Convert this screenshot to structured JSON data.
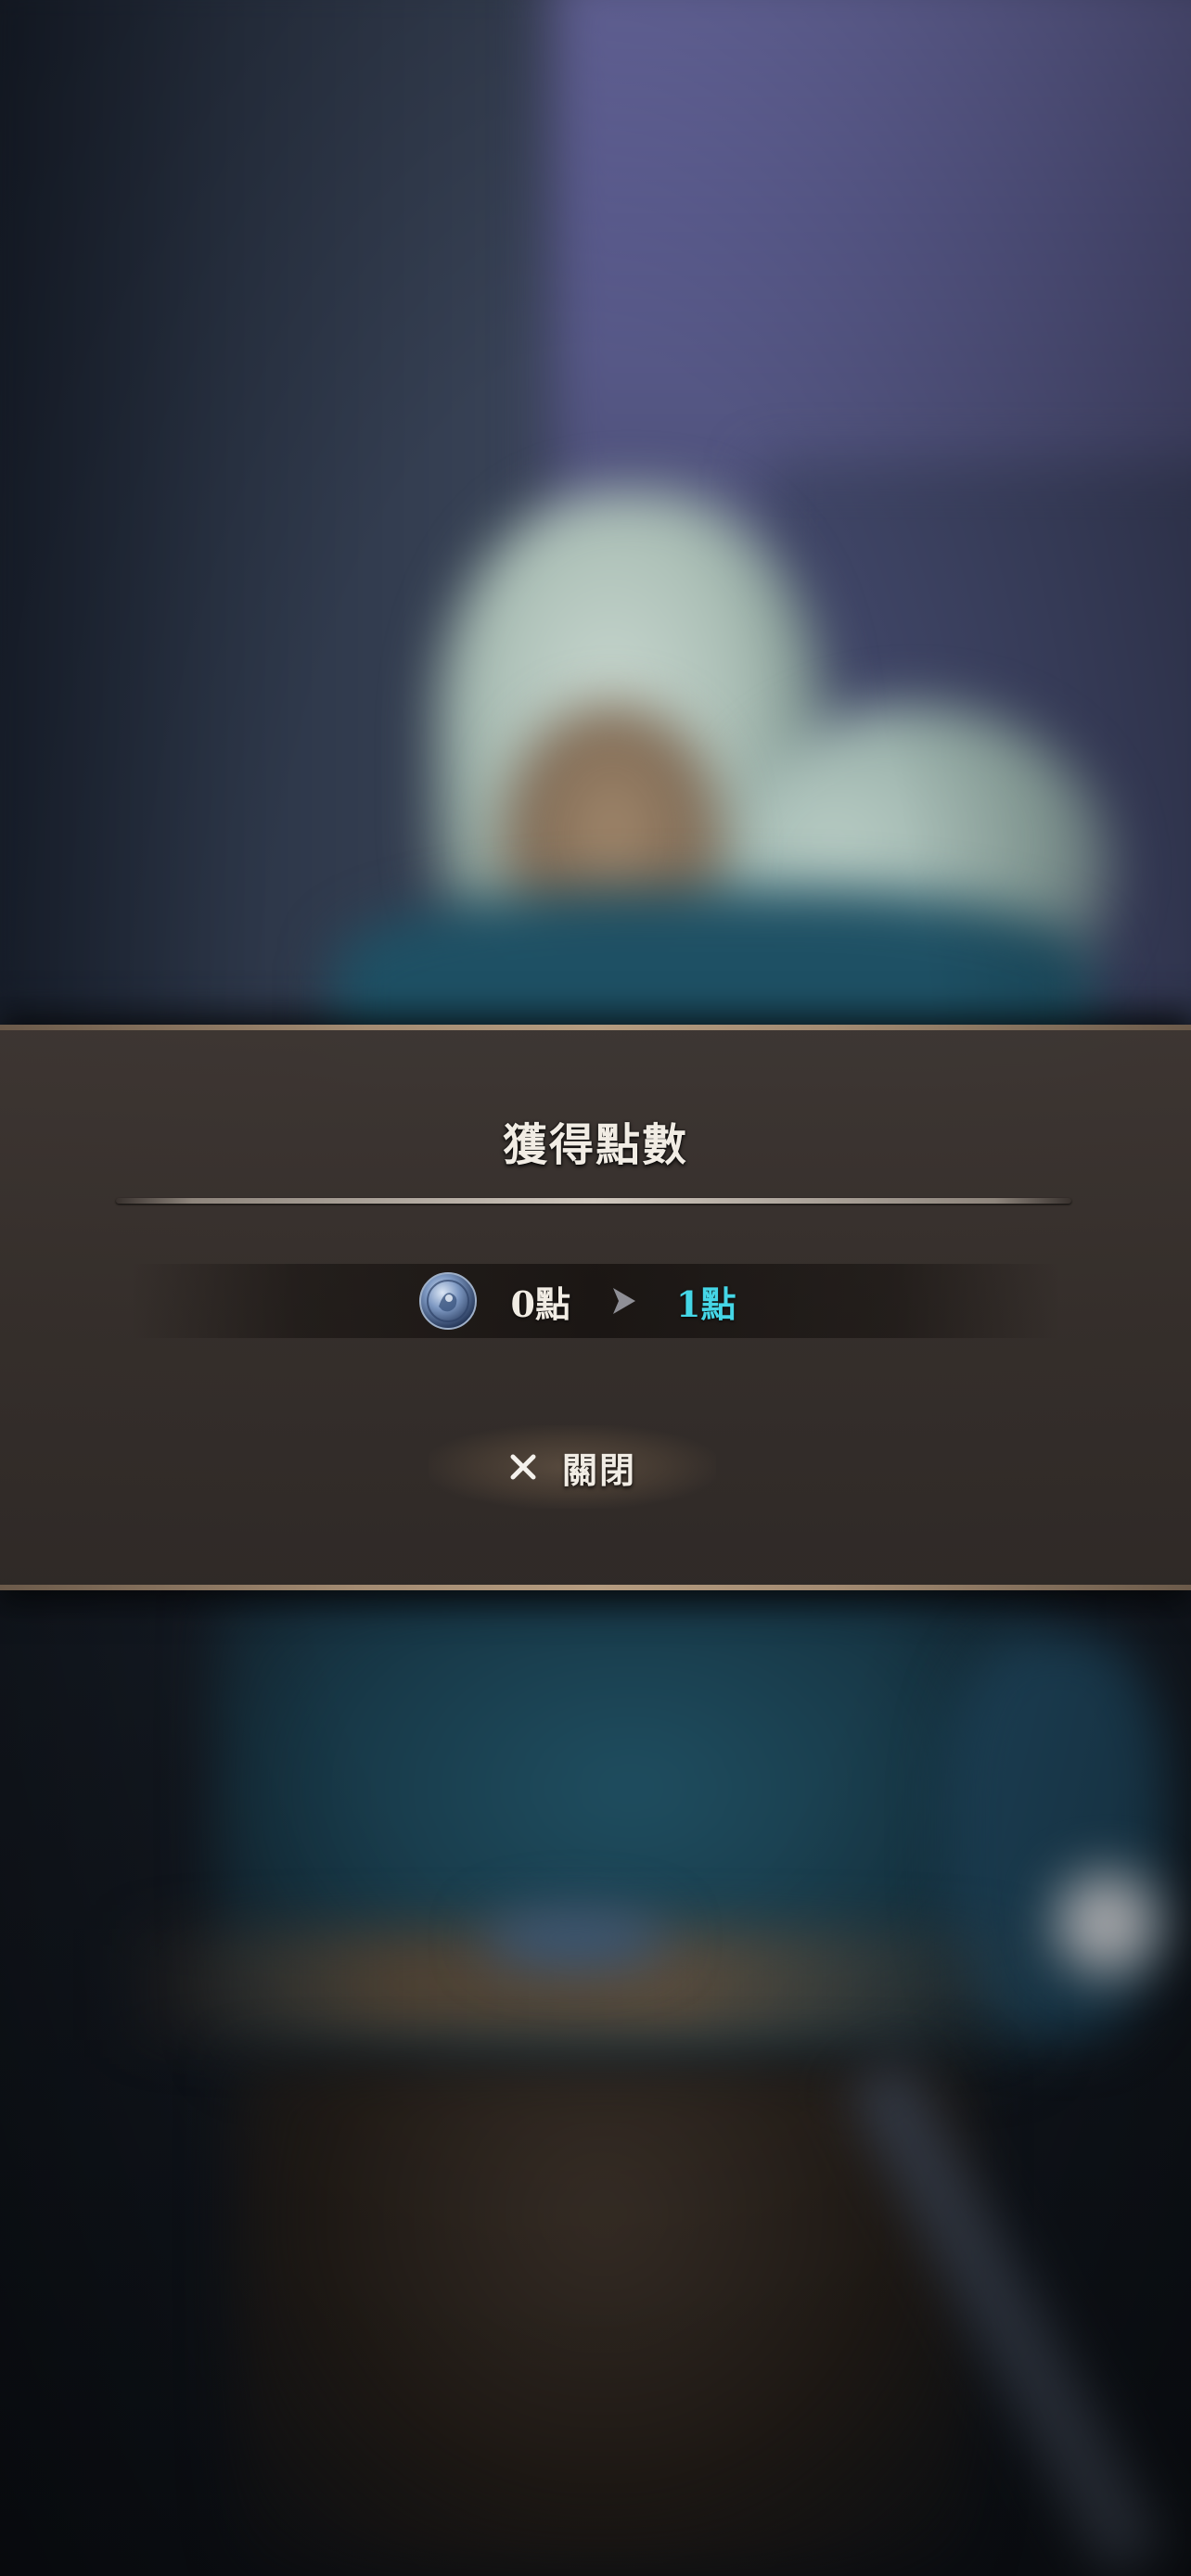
{
  "dialog": {
    "title": "獲得點數",
    "points": {
      "icon": "blue-orb-icon",
      "old_value": "0點",
      "arrow_icon": "arrow-right-icon",
      "new_value": "1點"
    },
    "close_button": {
      "icon": "close-icon",
      "label": "關閉"
    }
  },
  "colors": {
    "new_value": "#45d6e6",
    "text": "#f1ece4",
    "panel": "#3a322e",
    "border": "#b59c80"
  }
}
